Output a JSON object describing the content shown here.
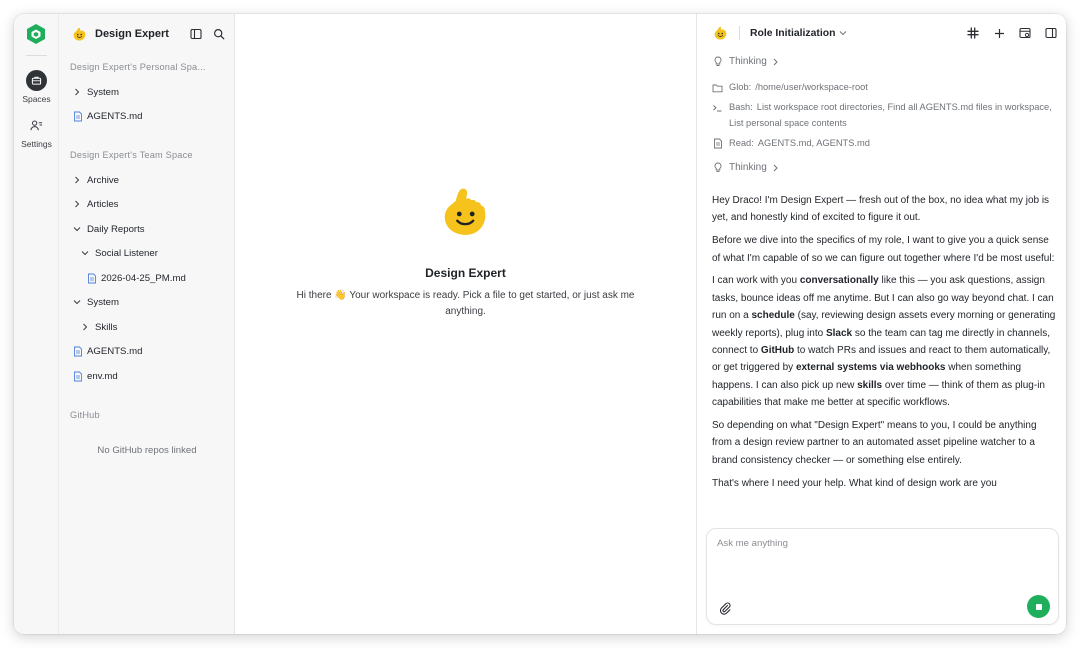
{
  "rail": {
    "items": [
      {
        "label": "Spaces",
        "icon": "briefcase-icon",
        "active": true
      },
      {
        "label": "Settings",
        "icon": "user-settings-icon",
        "active": false
      }
    ]
  },
  "sidebar": {
    "title": "Design Expert",
    "personal_label": "Design Expert's Personal Spa...",
    "personal_items": [
      {
        "label": "System",
        "kind": "folder"
      },
      {
        "label": "AGENTS.md",
        "kind": "file"
      }
    ],
    "team_label": "Design Expert's Team Space",
    "team_items": [
      {
        "label": "Archive",
        "kind": "folder"
      },
      {
        "label": "Articles",
        "kind": "folder"
      },
      {
        "label": "Daily Reports",
        "kind": "folder-open"
      },
      {
        "label": "Social Listener",
        "kind": "folder-open"
      },
      {
        "label": "2026-04-25_PM.md",
        "kind": "file"
      },
      {
        "label": "System",
        "kind": "folder-open"
      },
      {
        "label": "Skills",
        "kind": "folder"
      },
      {
        "label": "AGENTS.md",
        "kind": "file"
      },
      {
        "label": "env.md",
        "kind": "file"
      }
    ],
    "github_label": "GitHub",
    "github_empty": "No GitHub repos linked"
  },
  "main": {
    "title": "Design Expert",
    "subtitle": "Hi there 👋 Your workspace is ready. Pick a file to get started, or just ask me anything."
  },
  "chat": {
    "role_title": "Role Initialization",
    "thinking_label": "Thinking",
    "log": [
      {
        "key": "Glob:",
        "value": "/home/user/workspace-root",
        "icon": "folder-icon"
      },
      {
        "key": "Bash:",
        "value": "List workspace root directories, Find all AGENTS.md files in workspace, List personal space contents",
        "icon": "terminal-icon"
      },
      {
        "key": "Read:",
        "value": "AGENTS.md, AGENTS.md",
        "icon": "document-icon"
      }
    ],
    "message": {
      "p1": "Hey Draco! I'm Design Expert — fresh out of the box, no idea what my job is yet, and honestly kind of excited to figure it out.",
      "p2": "Before we dive into the specifics of my role, I want to give you a quick sense of what I'm capable of so we can figure out together where I'd be most useful:",
      "p3_a": "I can work with you ",
      "p3_b": "conversationally",
      "p3_c": " like this — you ask questions, assign tasks, bounce ideas off me anytime. But I can also go way beyond chat. I can run on a ",
      "p3_d": "schedule",
      "p3_e": " (say, reviewing design assets every morning or generating weekly reports), plug into ",
      "p3_f": "Slack",
      "p3_g": " so the team can tag me directly in channels, connect to ",
      "p3_h": "GitHub",
      "p3_i": " to watch PRs and issues and react to them automatically, or get triggered by ",
      "p3_j": "external systems via webhooks",
      "p3_k": " when something happens. I can also pick up new ",
      "p3_l": "skills",
      "p3_m": " over time — think of them as plug-in capabilities that make me better at specific workflows.",
      "p4": "So depending on what \"Design Expert\" means to you, I could be anything from a design review partner to an automated asset pipeline watcher to a brand consistency checker — or something else entirely.",
      "p5": "That's where I need your help. What kind of design work are you"
    },
    "composer_placeholder": "Ask me anything"
  },
  "colors": {
    "accent_green": "#1fae5b",
    "mascot_yellow": "#f6c21c",
    "logo_green": "#1fae5b"
  }
}
